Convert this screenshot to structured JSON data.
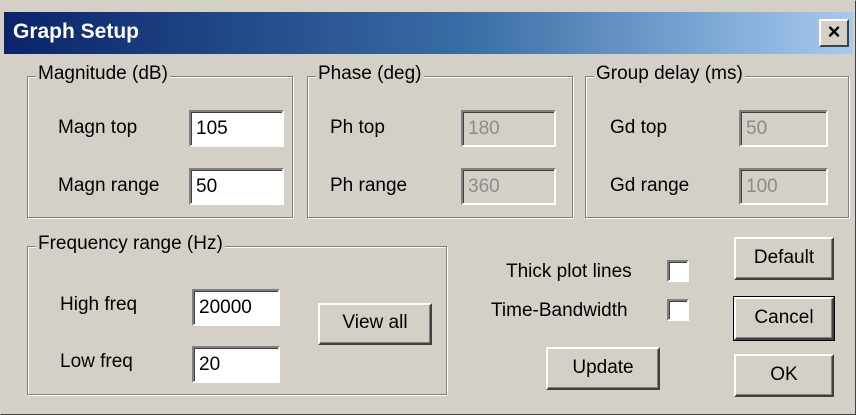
{
  "window": {
    "title": "Graph Setup",
    "close_glyph": "×"
  },
  "magnitude": {
    "legend": "Magnitude (dB)",
    "top_label": "Magn top",
    "top_value": "105",
    "range_label": "Magn range",
    "range_value": "50"
  },
  "phase": {
    "legend": "Phase (deg)",
    "top_label": "Ph top",
    "top_value": "180",
    "range_label": "Ph range",
    "range_value": "360"
  },
  "group_delay": {
    "legend": "Group delay (ms)",
    "top_label": "Gd top",
    "top_value": "50",
    "range_label": "Gd range",
    "range_value": "100"
  },
  "frequency": {
    "legend": "Frequency range (Hz)",
    "high_label": "High freq",
    "high_value": "20000",
    "low_label": "Low freq",
    "low_value": "20",
    "view_all_label": "View all"
  },
  "options": {
    "thick_lines_label": "Thick plot lines",
    "thick_lines_checked": false,
    "time_bandwidth_label": "Time-Bandwidth",
    "time_bandwidth_checked": false
  },
  "buttons": {
    "update": "Update",
    "default": "Default",
    "cancel": "Cancel",
    "ok": "OK"
  },
  "colors": {
    "title_start": "#0a246a",
    "title_end": "#a6caf0",
    "face": "#d4d0c8"
  }
}
